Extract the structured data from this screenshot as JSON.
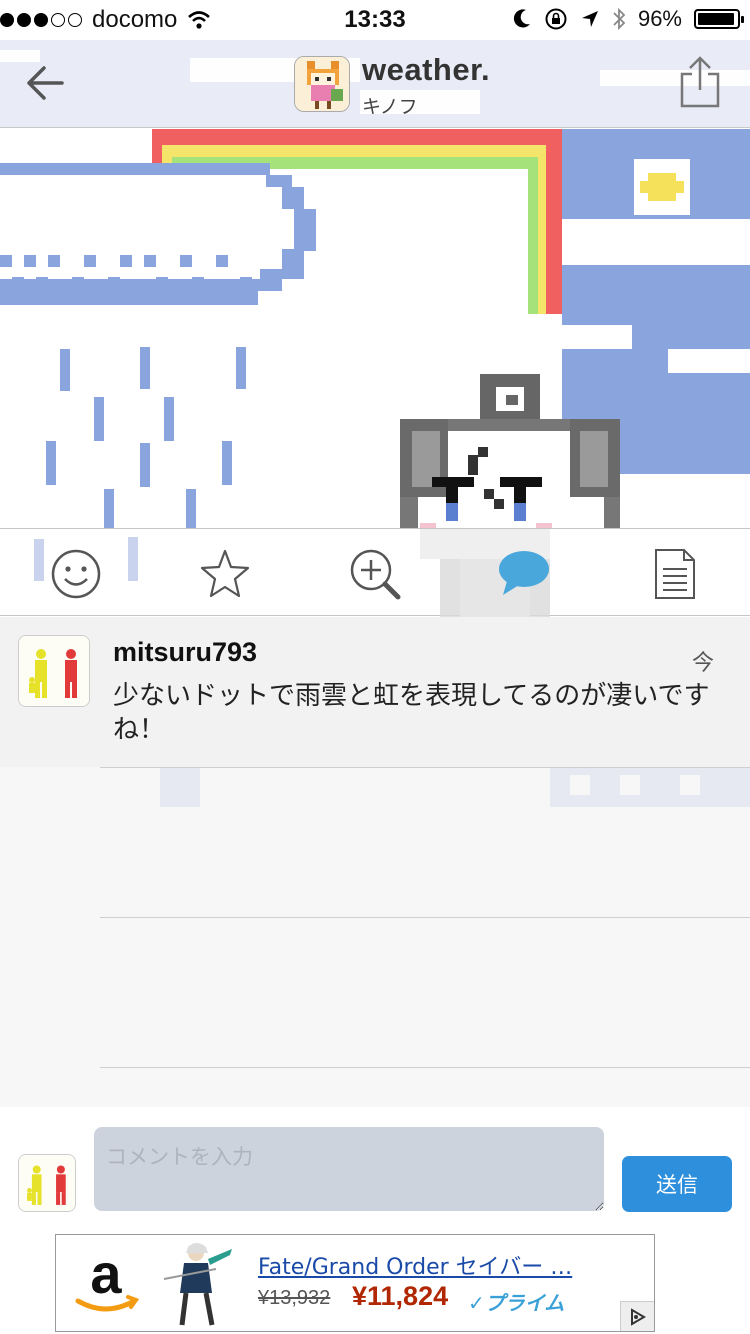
{
  "status_bar": {
    "carrier": "docomo",
    "time": "13:33",
    "battery_text": "96%",
    "battery_level": 0.96
  },
  "header": {
    "title": "weather.",
    "subtitle": "キノフ",
    "icons": [
      "back-arrow-icon",
      "share-icon"
    ]
  },
  "toolbar": {
    "icons": [
      "smiley-icon",
      "star-icon",
      "zoom-in-icon",
      "comment-icon",
      "document-icon"
    ],
    "active_color": "#4aa7db"
  },
  "comments": [
    {
      "user": "mitsuru793",
      "time": "今",
      "text": "少ないドットで雨雲と虹を表現してるのが凄いですね！"
    }
  ],
  "input": {
    "placeholder": "コメントを入力",
    "send_label": "送信"
  },
  "ad": {
    "title": "Fate/Grand Order セイバー …",
    "old_price": "¥13,932",
    "price": "¥11,824",
    "prime_label": "✓プライム"
  },
  "colors": {
    "cloud_blue": "#8aa4dd",
    "rainbow_red": "#f06060",
    "rainbow_yellow": "#f4e46a",
    "rainbow_green": "#a6e27a",
    "send_blue": "#2e8fdc"
  }
}
